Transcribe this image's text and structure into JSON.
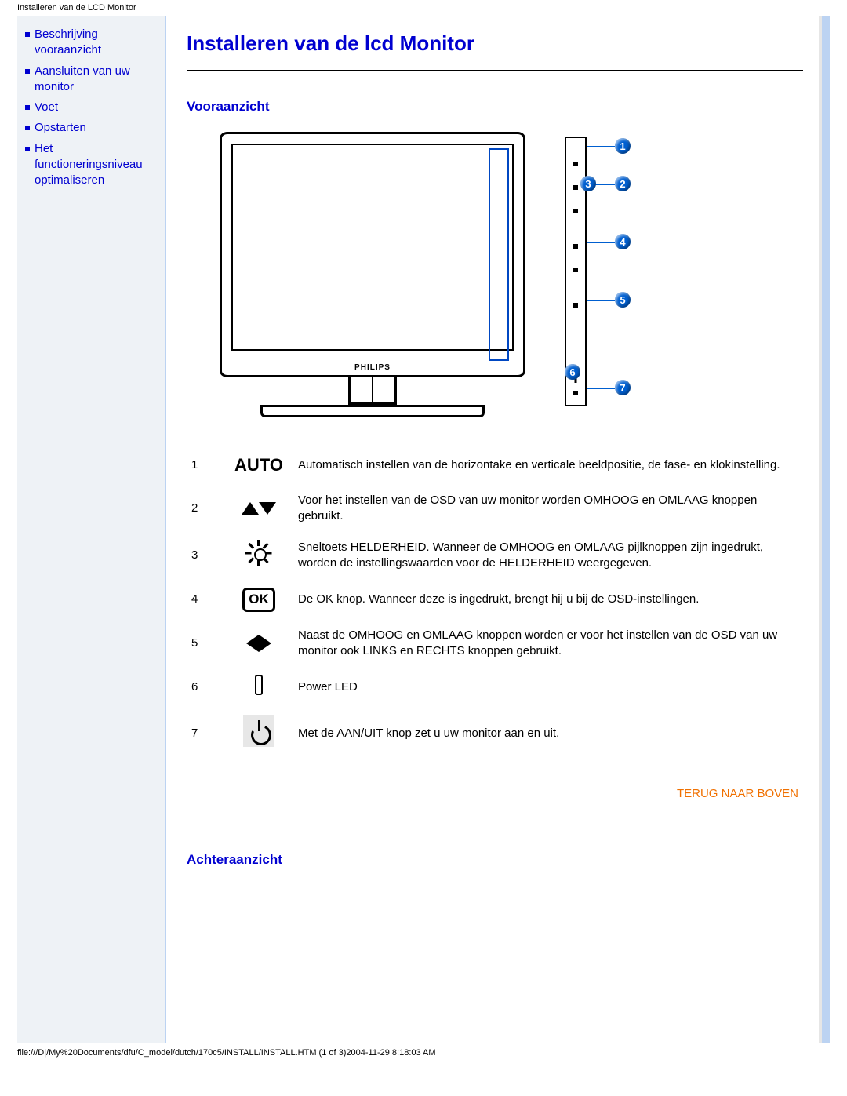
{
  "header": {
    "title": "Installeren van de LCD Monitor"
  },
  "sidebar": {
    "items": [
      {
        "label": "Beschrijving vooraanzicht"
      },
      {
        "label": "Aansluiten van uw monitor"
      },
      {
        "label": "Voet"
      },
      {
        "label": "Opstarten"
      },
      {
        "label": "Het functioneringsniveau optimaliseren"
      }
    ]
  },
  "page": {
    "title": "Installeren van de lcd Monitor",
    "section_front": "Vooraanzicht",
    "section_rear": "Achteraanzicht",
    "back_to_top": "TERUG NAAR BOVEN",
    "brand": "PHILIPS"
  },
  "legend": {
    "rows": [
      {
        "n": "1",
        "icon": "auto",
        "text": "Automatisch instellen van de horizontake en verticale beeldpositie, de fase- en klokinstelling."
      },
      {
        "n": "2",
        "icon": "updown",
        "text": "Voor het instellen van de OSD van uw monitor worden OMHOOG en OMLAAG knoppen gebruikt."
      },
      {
        "n": "3",
        "icon": "bright",
        "text": "Sneltoets HELDERHEID. Wanneer de OMHOOG en OMLAAG pijlknoppen zijn ingedrukt, worden de instellingswaarden voor de HELDERHEID weergegeven."
      },
      {
        "n": "4",
        "icon": "ok",
        "text": "De OK knop. Wanneer deze is ingedrukt, brengt hij u bij de OSD-instellingen."
      },
      {
        "n": "5",
        "icon": "leftright",
        "text": "Naast de OMHOOG en OMLAAG knoppen worden er voor het instellen van de OSD van uw monitor ook LINKS en RECHTS knoppen gebruikt."
      },
      {
        "n": "6",
        "icon": "led",
        "text": "Power LED"
      },
      {
        "n": "7",
        "icon": "power",
        "text": "Met de AAN/UIT knop zet u uw monitor aan en uit."
      }
    ],
    "auto_label": "AUTO",
    "ok_label": "OK"
  },
  "footer": "file:///D|/My%20Documents/dfu/C_model/dutch/170c5/INSTALL/INSTALL.HTM (1 of 3)2004-11-29 8:18:03 AM"
}
